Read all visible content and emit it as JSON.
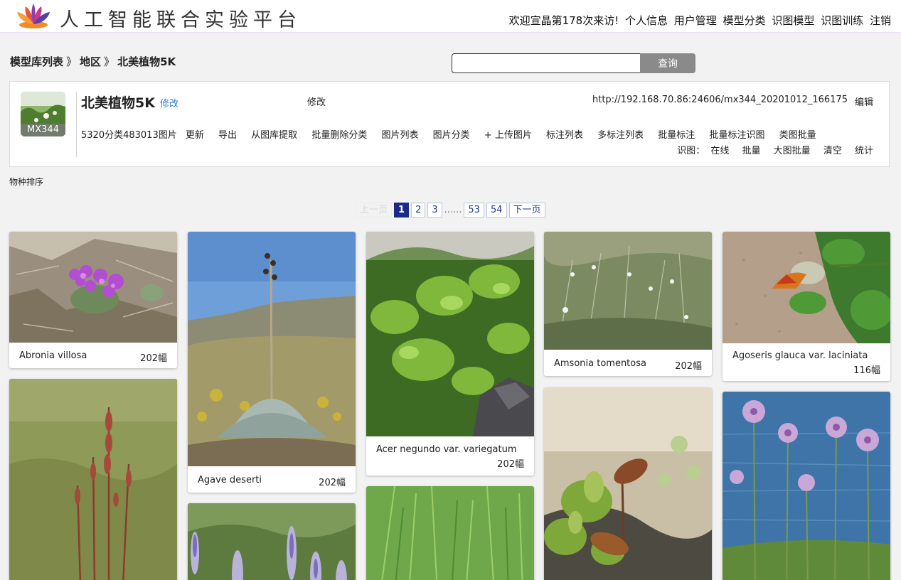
{
  "header": {
    "site_title": "人工智能联合实验平台",
    "welcome": "欢迎宣晶第178次来访!",
    "nav": [
      "个人信息",
      "用户管理",
      "模型分类",
      "识图模型",
      "识图训练",
      "注销"
    ]
  },
  "breadcrumb": {
    "items": [
      "模型库列表",
      "地区",
      "北美植物5K"
    ],
    "separator": "》"
  },
  "search": {
    "value": "",
    "placeholder": "",
    "button_label": "查询"
  },
  "model": {
    "code": "MX344",
    "title": "北美植物5K",
    "title_edit": "修改",
    "edit_label": "修改",
    "url": "http://192.168.70.86:24606/mx344_20201012_166175",
    "url_edit": "编辑",
    "stats": "5320分类483013图片",
    "actions": [
      "更新",
      "导出",
      "从图库提取",
      "批量删除分类",
      "图片列表",
      "图片分类",
      "+ 上传图片",
      "标注列表",
      "多标注列表",
      "批量标注",
      "批量标注识图",
      "类图批量"
    ],
    "recog_label": "识图：",
    "recog_actions": [
      "在线",
      "批量",
      "大图批量",
      "清空",
      "统计"
    ]
  },
  "sort_label": "物种排序",
  "pagination": {
    "prev": "上一页",
    "pages": [
      "1",
      "2",
      "3"
    ],
    "ellipsis": "......",
    "tail_pages": [
      "53",
      "54"
    ],
    "next": "下一页",
    "current": "1"
  },
  "cards": [
    {
      "name": "Abronia villosa",
      "count": "202幅"
    },
    {
      "name": "Agave deserti",
      "count": "202幅"
    },
    {
      "name": "Acer negundo var. variegatum",
      "count": "202幅"
    },
    {
      "name": "Amsonia tomentosa",
      "count": "202幅"
    },
    {
      "name": "Agoseris glauca var. laciniata",
      "count": "116幅"
    }
  ],
  "colors": {
    "accent_blue": "#2a7bd8",
    "pager_active": "#1a2a86",
    "search_button": "#8a8a8a",
    "header_band": "#f4eef7"
  }
}
